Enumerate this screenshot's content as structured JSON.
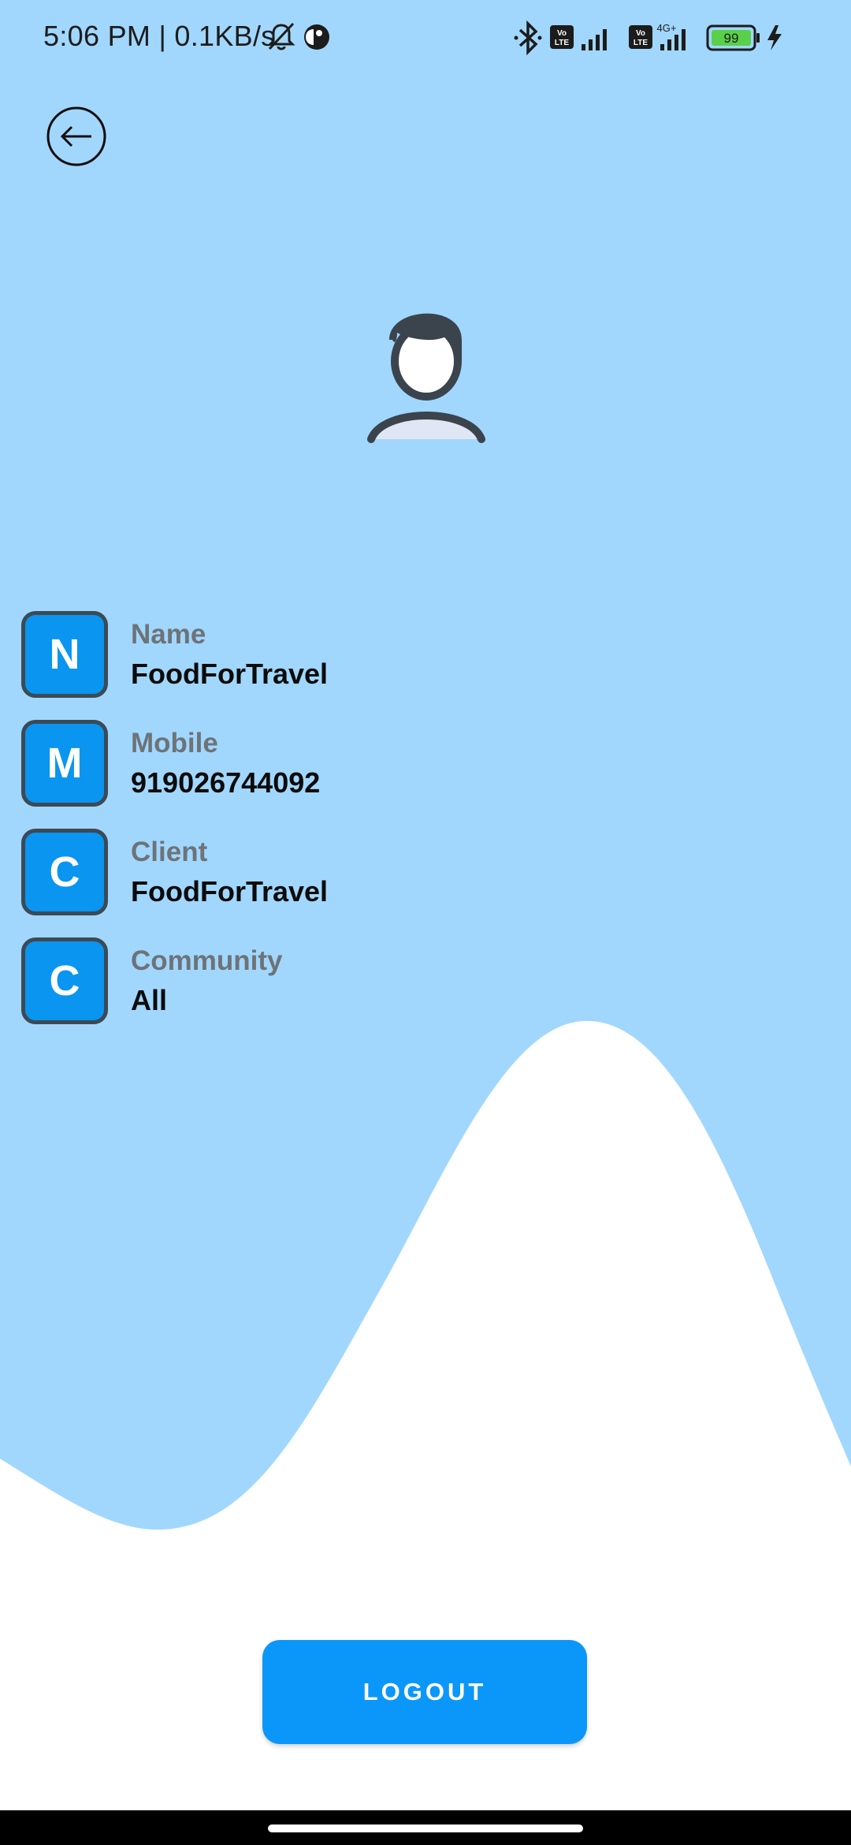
{
  "status_bar": {
    "time_speed": "5:06 PM | 0.1KB/s",
    "volte_1": "Vo LTE",
    "volte_2": "Vo LTE",
    "network_type": "4G+",
    "battery": "99",
    "icons": [
      "bell-muted-icon",
      "app-notification-icon",
      "bluetooth-icon",
      "volte-icon",
      "signal-icon",
      "battery-icon",
      "charging-icon"
    ]
  },
  "header": {
    "back_icon": "arrow-left-icon"
  },
  "profile": {
    "avatar_icon": "user-avatar-icon",
    "fields": [
      {
        "letter": "N",
        "label": "Name",
        "value": "FoodForTravel"
      },
      {
        "letter": "M",
        "label": "Mobile",
        "value": "919026744092"
      },
      {
        "letter": "C",
        "label": "Client",
        "value": "FoodForTravel"
      },
      {
        "letter": "C",
        "label": "Community",
        "value": "All"
      }
    ]
  },
  "actions": {
    "logout_label": "LOGOUT"
  },
  "colors": {
    "background": "#a1d7fd",
    "wave": "#ffffff",
    "accent": "#0a97f9",
    "letter_box_border": "#3c4a55",
    "label": "#6d7378"
  }
}
